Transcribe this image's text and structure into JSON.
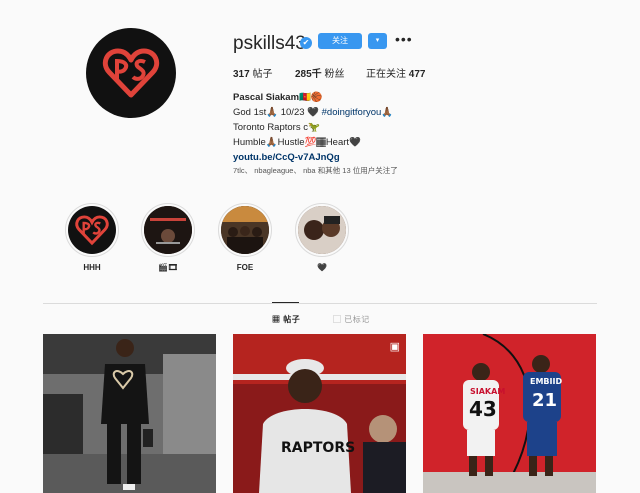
{
  "header": {
    "username": "pskills43",
    "verified_icon": "✔",
    "follow_label": "关注",
    "dropdown_icon": "▾",
    "more_icon": "•••"
  },
  "stats": {
    "posts_count": "317",
    "posts_label": "帖子",
    "followers_count": "285千",
    "followers_label": "粉丝",
    "following_label": "正在关注",
    "following_count": "477"
  },
  "bio": {
    "name": "Pascal Siakam🇨🇲🏀",
    "line1_prefix": "God 1st🙏🏾 10/23 🖤 ",
    "line1_tag": "#doingitforyou",
    "line1_suffix": "🙏🏾",
    "line2": "Toronto Raptors c🦖",
    "line3": "Humble🙏🏾Hustle💯🏾Heart🖤",
    "link": "youtu.be/CcQ-v7AJnQg"
  },
  "followed_by": {
    "accounts": [
      "7tlc",
      "nbagleague",
      "nba"
    ],
    "suffix": "和其他 13 位用户关注了"
  },
  "highlights": [
    {
      "label": "HHH"
    },
    {
      "label": "🎬🎞"
    },
    {
      "label": "FOE"
    },
    {
      "label": "🖤"
    }
  ],
  "tabs": {
    "posts_icon": "▦",
    "posts_label": "帖子",
    "tagged_icon": "▢",
    "tagged_label": "已标记"
  },
  "posts": [
    {
      "badge": "",
      "jersey": ""
    },
    {
      "badge": "▣",
      "jersey": "RAPTORS"
    },
    {
      "badge": "",
      "jersey_left": "SIAKAM",
      "number_left": "43",
      "jersey_right": "EMBIID",
      "number_right": "21"
    }
  ],
  "colors": {
    "accent": "#3897f0",
    "heart_red": "#e0433a",
    "raptors_red": "#c8102e",
    "sixers_blue": "#1d428a"
  }
}
